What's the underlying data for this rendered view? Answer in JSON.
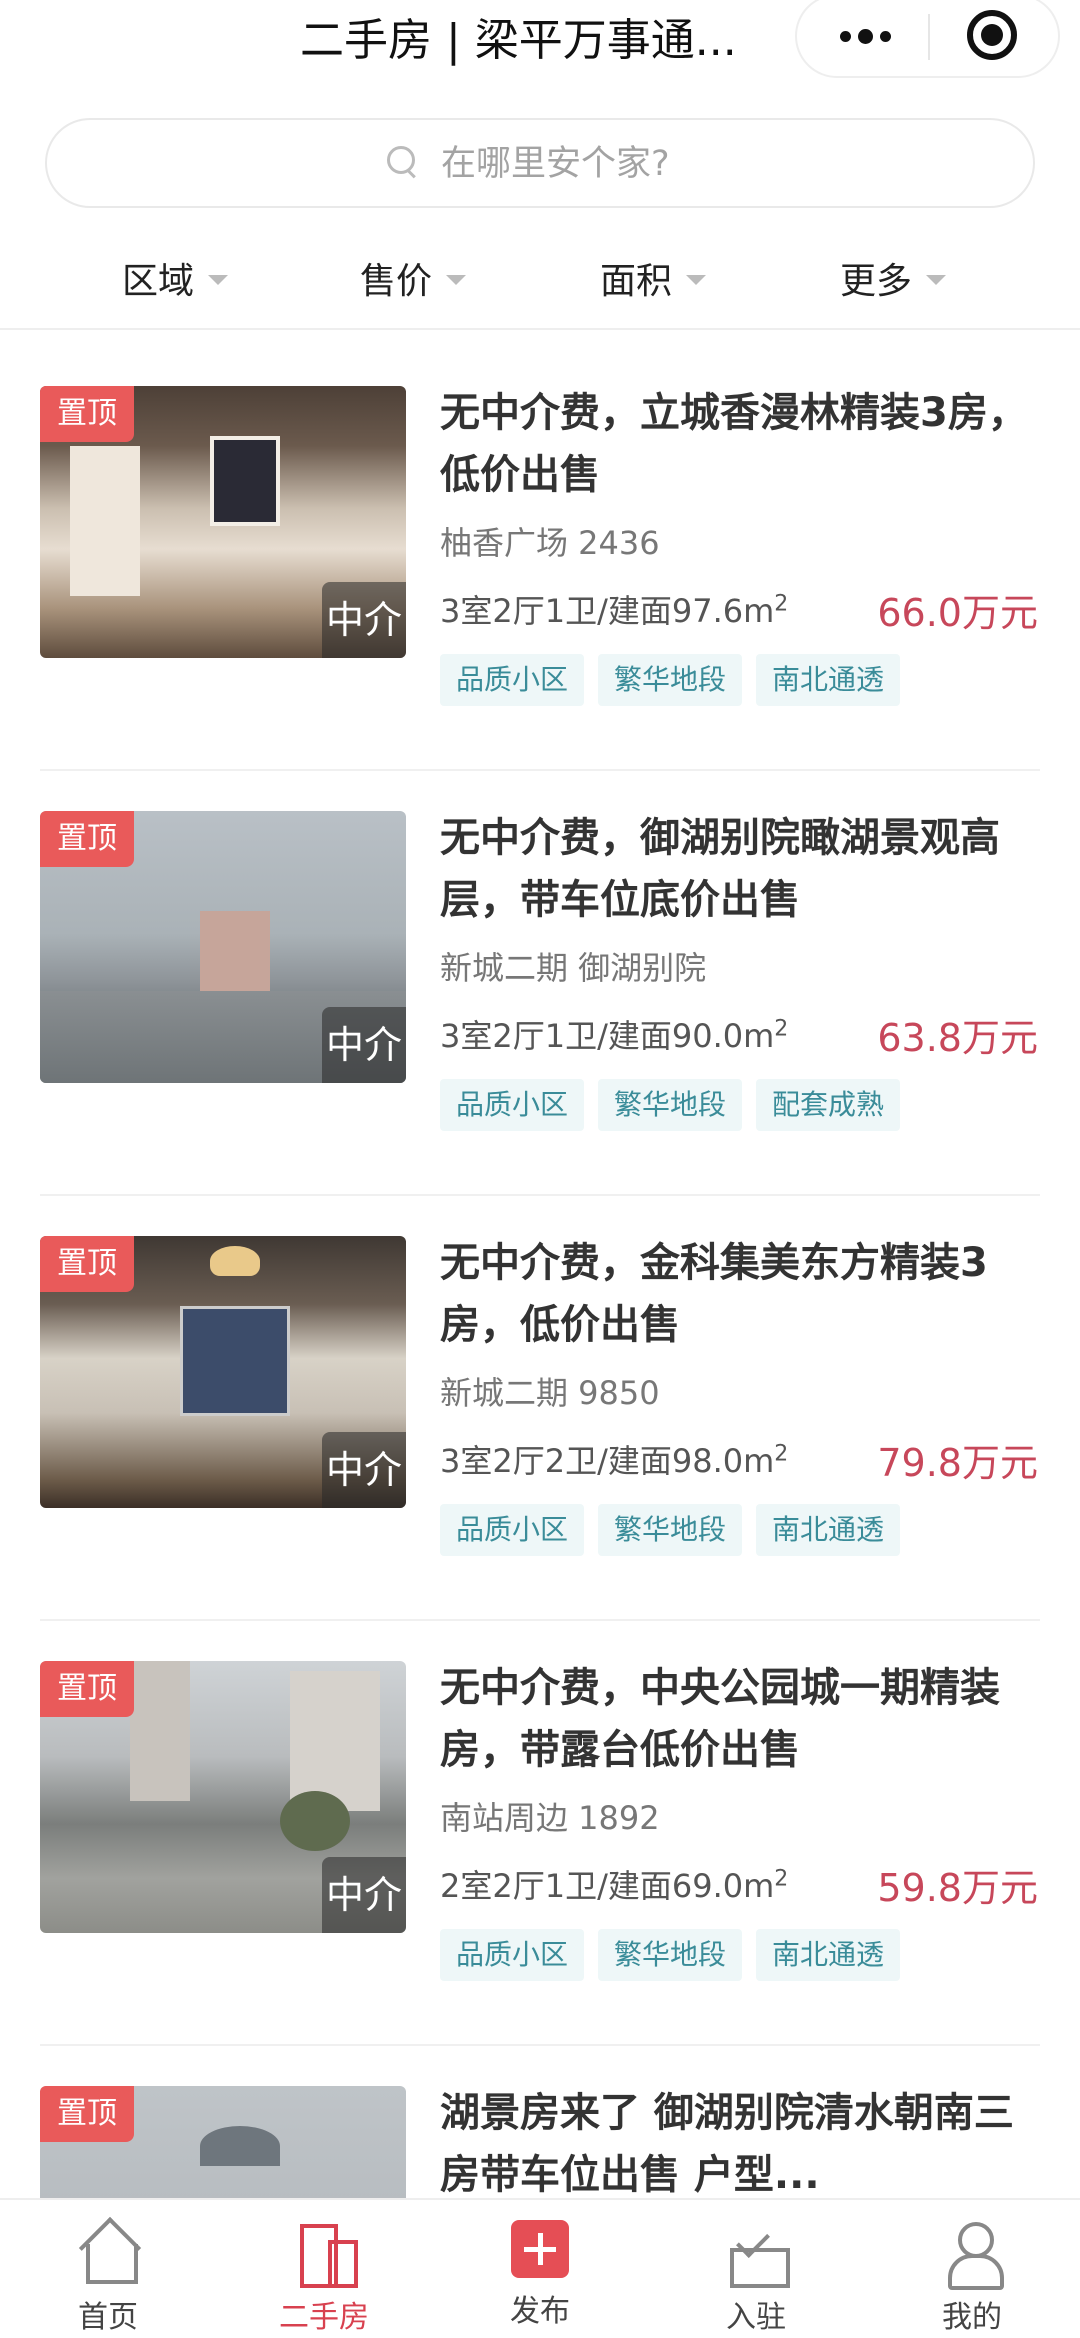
{
  "header": {
    "title": "二手房 | 梁平万事通..."
  },
  "search": {
    "placeholder": "在哪里安个家?"
  },
  "filters": [
    "区域",
    "售价",
    "面积",
    "更多"
  ],
  "listings": [
    {
      "pin": "置顶",
      "agent": "中介",
      "title": "无中介费，立城香漫林精装3房，低价出售",
      "location": "柚香广场 2436",
      "spec": "3室2厅1卫/建面97.6m",
      "spec_sup": "2",
      "price": "66.0万元",
      "tags": [
        "品质小区",
        "繁华地段",
        "南北通透"
      ]
    },
    {
      "pin": "置顶",
      "agent": "中介",
      "title": "无中介费，御湖别院瞰湖景观高层，带车位底价出售",
      "location": "新城二期 御湖别院",
      "spec": "3室2厅1卫/建面90.0m",
      "spec_sup": "2",
      "price": "63.8万元",
      "tags": [
        "品质小区",
        "繁华地段",
        "配套成熟"
      ]
    },
    {
      "pin": "置顶",
      "agent": "中介",
      "title": "无中介费，金科集美东方精装3房，低价出售",
      "location": "新城二期 9850",
      "spec": "3室2厅2卫/建面98.0m",
      "spec_sup": "2",
      "price": "79.8万元",
      "tags": [
        "品质小区",
        "繁华地段",
        "南北通透"
      ]
    },
    {
      "pin": "置顶",
      "agent": "中介",
      "title": "无中介费，中央公园城一期精装房，带露台低价出售",
      "location": "南站周边 1892",
      "spec": "2室2厅1卫/建面69.0m",
      "spec_sup": "2",
      "price": "59.8万元",
      "tags": [
        "品质小区",
        "繁华地段",
        "南北通透"
      ]
    },
    {
      "pin": "置顶",
      "title": "湖景房来了 御湖别院清水朝南三房带车位出售 户型..."
    }
  ],
  "tabbar": [
    {
      "label": "首页",
      "icon": "home-icon"
    },
    {
      "label": "二手房",
      "icon": "building-icon"
    },
    {
      "label": "发布",
      "icon": "add-icon"
    },
    {
      "label": "入驻",
      "icon": "inbox-icon"
    },
    {
      "label": "我的",
      "icon": "user-icon"
    }
  ],
  "colors": {
    "accent": "#d8414f",
    "pin": "#e95a5a",
    "price": "#c7475a",
    "tag_bg": "#eef7f8",
    "tag_text": "#3a8c99"
  }
}
